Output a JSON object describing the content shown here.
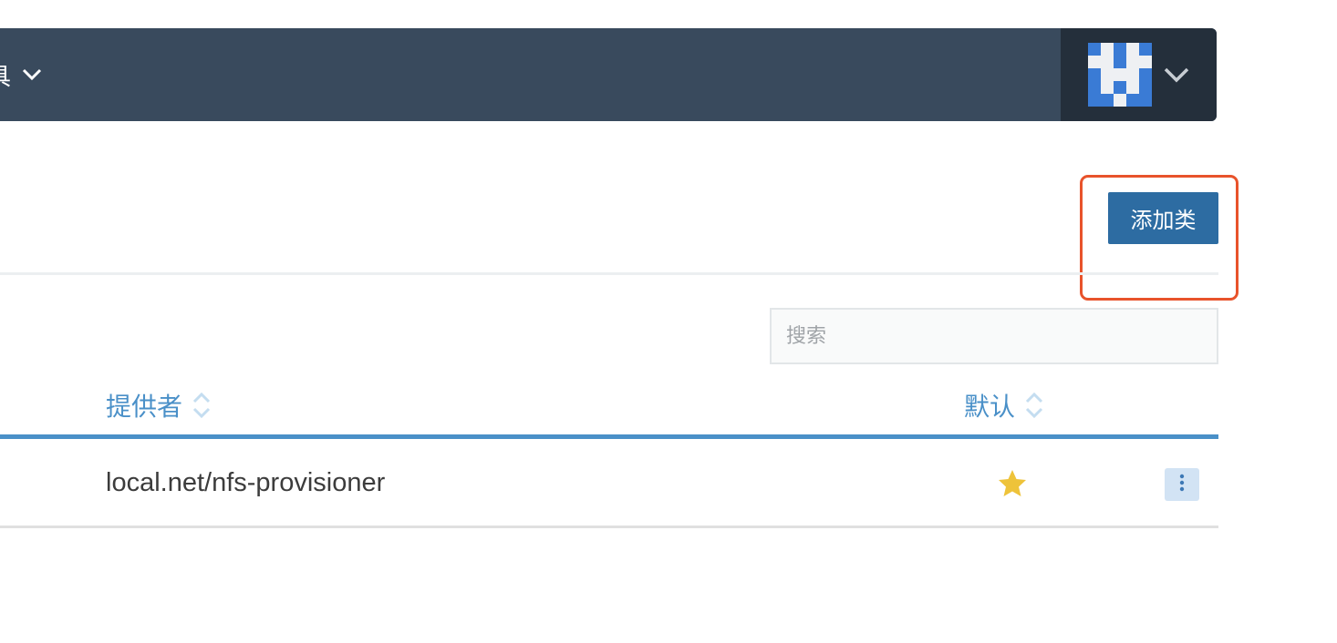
{
  "header": {
    "nav_label_partial": "具",
    "icons": [
      "chevron-down-icon",
      "user-avatar",
      "chevron-down-icon"
    ],
    "colors": {
      "bar": "#394a5d",
      "user_area": "#242f3b"
    }
  },
  "toolbar": {
    "add_class_label": "添加类",
    "accent": "#2d6ca2"
  },
  "search": {
    "placeholder": "搜索",
    "value": ""
  },
  "table": {
    "columns": [
      {
        "label": "提供者",
        "sortable": true
      },
      {
        "label": "默认",
        "sortable": true
      }
    ],
    "rows": [
      {
        "provider": "local.net/nfs-provisioner",
        "default": true,
        "icons": [
          "star-icon",
          "kebab-menu-icon"
        ]
      }
    ],
    "accent": "#4a90c8"
  },
  "annotation": {
    "highlight_color": "#e8532b"
  }
}
